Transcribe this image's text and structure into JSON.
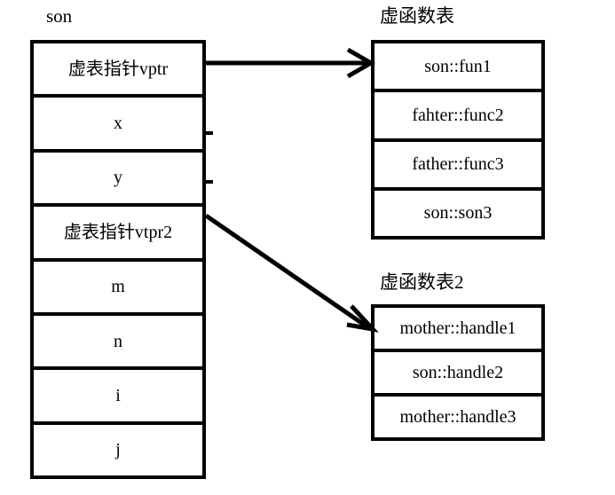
{
  "diagram": {
    "title_son": "son",
    "title_vtable1": "虚函数表",
    "title_vtable2": "虚函数表2"
  },
  "object_layout": {
    "name": "son",
    "rows": [
      {
        "label": "虚表指针vptr"
      },
      {
        "label": "x"
      },
      {
        "label": "y"
      },
      {
        "label": "虚表指针vtpr2"
      },
      {
        "label": "m"
      },
      {
        "label": "n"
      },
      {
        "label": "i"
      },
      {
        "label": "j"
      }
    ]
  },
  "vtable1": {
    "name": "虚函数表",
    "rows": [
      {
        "label": "son::fun1"
      },
      {
        "label": "fahter::func2"
      },
      {
        "label": "father::func3"
      },
      {
        "label": "son::son3"
      }
    ]
  },
  "vtable2": {
    "name": "虚函数表2",
    "rows": [
      {
        "label": "mother::handle1"
      },
      {
        "label": "son::handle2"
      },
      {
        "label": "mother::handle3"
      }
    ]
  },
  "arrows": [
    {
      "name": "vptr-to-vtable1",
      "from": "虚表指针vptr",
      "to": "son::fun1"
    },
    {
      "name": "vtpr2-to-vtable2",
      "from": "虚表指针vtpr2",
      "to": "mother::handle1"
    }
  ],
  "colors": {
    "stroke": "#000000",
    "background": "#ffffff",
    "text": "#000000"
  }
}
